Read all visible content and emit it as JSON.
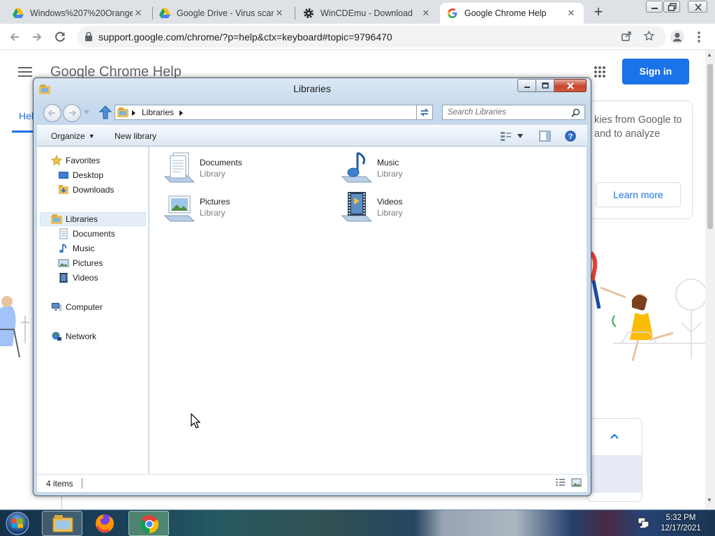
{
  "browser": {
    "tabs": [
      {
        "title": "Windows%207%20Orange",
        "close": "✕",
        "icon": "google-drive-icon"
      },
      {
        "title": "Google Drive - Virus scan w",
        "close": "✕",
        "icon": "google-drive-icon"
      },
      {
        "title": "WinCDEmu - Download",
        "close": "✕",
        "icon": "gear-icon"
      },
      {
        "title": "Google Chrome Help",
        "close": "✕",
        "icon": "google-g-icon"
      }
    ],
    "new_tab": "+",
    "url": "support.google.com/chrome/?p=help&ctx=keyboard#topic=9796470"
  },
  "page": {
    "site_title": "Google Chrome Help",
    "signin": "Sign in",
    "help_tab": "Help",
    "cookie_text": "kies from Google to and to analyze",
    "learn_more": "Learn more"
  },
  "explorer": {
    "title": "Libraries",
    "breadcrumb": "Libraries",
    "search_placeholder": "Search Libraries",
    "commands": {
      "organize": "Organize",
      "new_library": "New library"
    },
    "tree": {
      "favorites": "Favorites",
      "desktop": "Desktop",
      "downloads": "Downloads",
      "libraries": "Libraries",
      "documents": "Documents",
      "music": "Music",
      "pictures": "Pictures",
      "videos": "Videos",
      "computer": "Computer",
      "network": "Network"
    },
    "items": [
      {
        "name": "Documents",
        "type": "Library"
      },
      {
        "name": "Music",
        "type": "Library"
      },
      {
        "name": "Pictures",
        "type": "Library"
      },
      {
        "name": "Videos",
        "type": "Library"
      }
    ],
    "status": "4 items"
  },
  "taskbar": {
    "time": "5:32 PM",
    "date": "12/17/2021"
  }
}
